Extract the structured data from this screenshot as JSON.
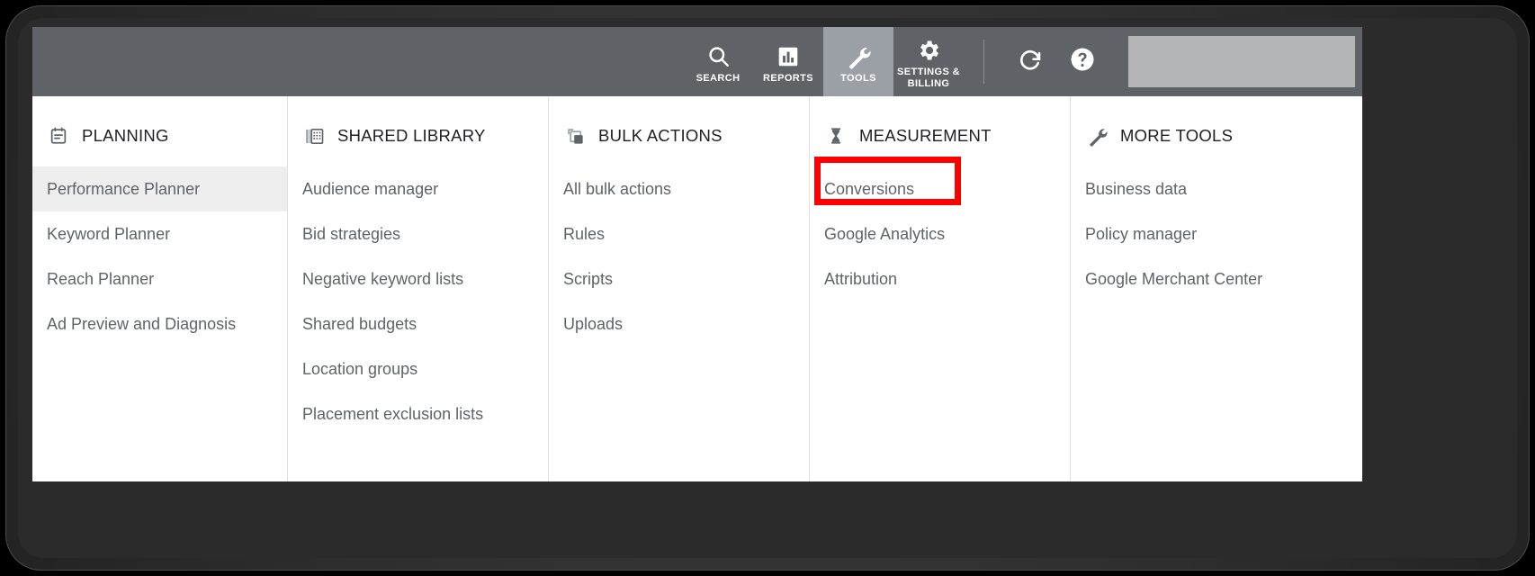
{
  "app_bar": {
    "nav_items": [
      {
        "label": "SEARCH",
        "icon": "search-icon",
        "selected": false
      },
      {
        "label": "REPORTS",
        "icon": "reports-bar-chart-icon",
        "selected": false
      },
      {
        "label": "TOOLS",
        "icon": "wrench-icon",
        "selected": true
      },
      {
        "label": "SETTINGS &\nBILLING",
        "icon": "gear-icon",
        "selected": false
      }
    ],
    "refresh_label": "refresh-icon",
    "help_label": "help-icon",
    "account_block_label": "",
    "background_color": "#5f6368",
    "selected_color": "#9aa0a6"
  },
  "panel": {
    "columns": [
      {
        "title": "PLANNING",
        "icon": "clipboard-icon",
        "items": [
          {
            "label": "Performance Planner",
            "highlighted": true
          },
          {
            "label": "Keyword Planner",
            "highlighted": false
          },
          {
            "label": "Reach Planner",
            "highlighted": false
          },
          {
            "label": "Ad Preview and Diagnosis",
            "highlighted": false
          }
        ]
      },
      {
        "title": "SHARED LIBRARY",
        "icon": "library-grid-icon",
        "items": [
          {
            "label": "Audience manager",
            "highlighted": false
          },
          {
            "label": "Bid strategies",
            "highlighted": false
          },
          {
            "label": "Negative keyword lists",
            "highlighted": false
          },
          {
            "label": "Shared budgets",
            "highlighted": false
          },
          {
            "label": "Location groups",
            "highlighted": false
          },
          {
            "label": "Placement exclusion lists",
            "highlighted": false
          }
        ]
      },
      {
        "title": "BULK ACTIONS",
        "icon": "stacked-layers-icon",
        "items": [
          {
            "label": "All bulk actions",
            "highlighted": false
          },
          {
            "label": "Rules",
            "highlighted": false
          },
          {
            "label": "Scripts",
            "highlighted": false
          },
          {
            "label": "Uploads",
            "highlighted": false
          }
        ]
      },
      {
        "title": "MEASUREMENT",
        "icon": "hourglass-icon",
        "items": [
          {
            "label": "Conversions",
            "highlighted": false,
            "annotated": true
          },
          {
            "label": "Google Analytics",
            "highlighted": false
          },
          {
            "label": "Attribution",
            "highlighted": false
          }
        ]
      },
      {
        "title": "MORE TOOLS",
        "icon": "wrench-icon",
        "items": [
          {
            "label": "Business data",
            "highlighted": false
          },
          {
            "label": "Policy manager",
            "highlighted": false
          },
          {
            "label": "Google Merchant Center",
            "highlighted": false
          }
        ]
      }
    ]
  },
  "annotation": {
    "color": "#ff0000",
    "target": "Conversions"
  }
}
